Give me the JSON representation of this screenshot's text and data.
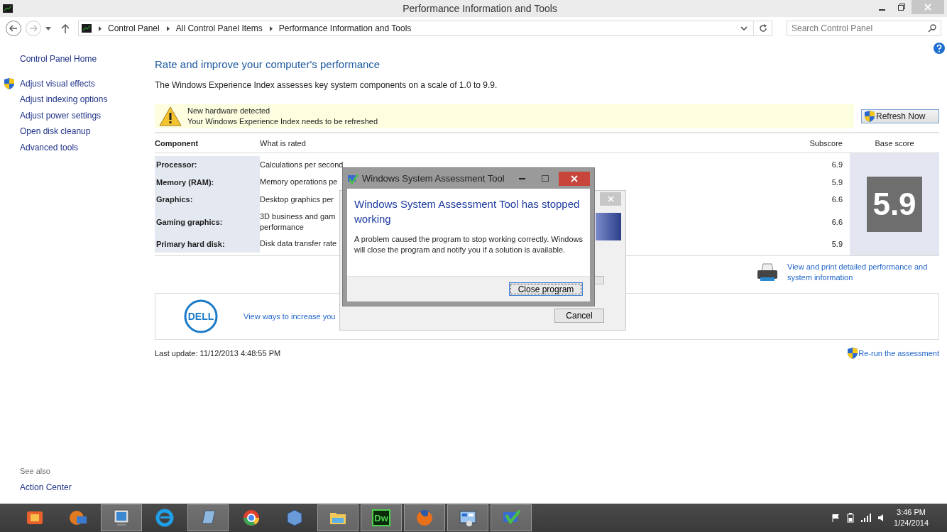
{
  "window": {
    "title": "Performance Information and Tools"
  },
  "address_bar": {
    "breadcrumbs": [
      "Control Panel",
      "All Control Panel Items",
      "Performance Information and Tools"
    ]
  },
  "search": {
    "placeholder": "Search Control Panel"
  },
  "sidebar": {
    "home": "Control Panel Home",
    "items": [
      {
        "label": "Adjust visual effects",
        "shield": true
      },
      {
        "label": "Adjust indexing options",
        "shield": false
      },
      {
        "label": "Adjust power settings",
        "shield": false
      },
      {
        "label": "Open disk cleanup",
        "shield": false
      },
      {
        "label": "Advanced tools",
        "shield": false
      }
    ],
    "see_also_heading": "See also",
    "see_also": [
      "Action Center"
    ]
  },
  "page": {
    "heading": "Rate and improve your computer's performance",
    "intro": "The Windows Experience Index assesses key system components on a scale of 1.0 to 9.9.",
    "notice": {
      "title": "New hardware detected",
      "message": "Your Windows Experience Index needs to be refreshed",
      "button": "Refresh Now"
    },
    "table": {
      "columns": [
        "Component",
        "What is rated",
        "Subscore",
        "Base score"
      ],
      "rows": [
        {
          "component": "Processor:",
          "rated": "Calculations per second",
          "subscore": "6.9"
        },
        {
          "component": "Memory (RAM):",
          "rated": "Memory operations pe",
          "subscore": "5.9"
        },
        {
          "component": "Graphics:",
          "rated": "Desktop graphics per",
          "subscore": "6.6"
        },
        {
          "component": "Gaming graphics:",
          "rated": "3D business and gam\nperformance",
          "subscore": "6.6"
        },
        {
          "component": "Primary hard disk:",
          "rated": "Disk data transfer rate",
          "subscore": "5.9"
        }
      ],
      "base_score": "5.9"
    },
    "print_link": "View and print detailed performance and system information",
    "banner": {
      "logo_text": "DELL",
      "link": "View ways to increase you"
    },
    "last_update": "Last update: 11/12/2013 4:48:55 PM",
    "rerun": "Re-run the assessment"
  },
  "background_dialog": {
    "button": "Cancel",
    "level": 0
  },
  "dialog": {
    "title": "Windows System Assessment Tool",
    "heading": "Windows System Assessment Tool has stopped working",
    "message": "A problem caused the program to stop working correctly. Windows will close the program and notify you if a solution is available.",
    "button": "Close program"
  },
  "taskbar": {
    "apps": [
      {
        "kind": "media",
        "active": false
      },
      {
        "kind": "film",
        "active": false
      },
      {
        "kind": "monitor",
        "active": true
      },
      {
        "kind": "ie",
        "active": false
      },
      {
        "kind": "notes",
        "active": true
      },
      {
        "kind": "chrome",
        "active": false
      },
      {
        "kind": "box",
        "active": false
      },
      {
        "kind": "folder",
        "active": true
      },
      {
        "kind": "dw",
        "active": true,
        "label": "Dw"
      },
      {
        "kind": "firefox",
        "active": true
      },
      {
        "kind": "panel",
        "active": true
      },
      {
        "kind": "check",
        "active": true
      }
    ],
    "time": "3:46 PM",
    "date": "1/24/2014"
  }
}
